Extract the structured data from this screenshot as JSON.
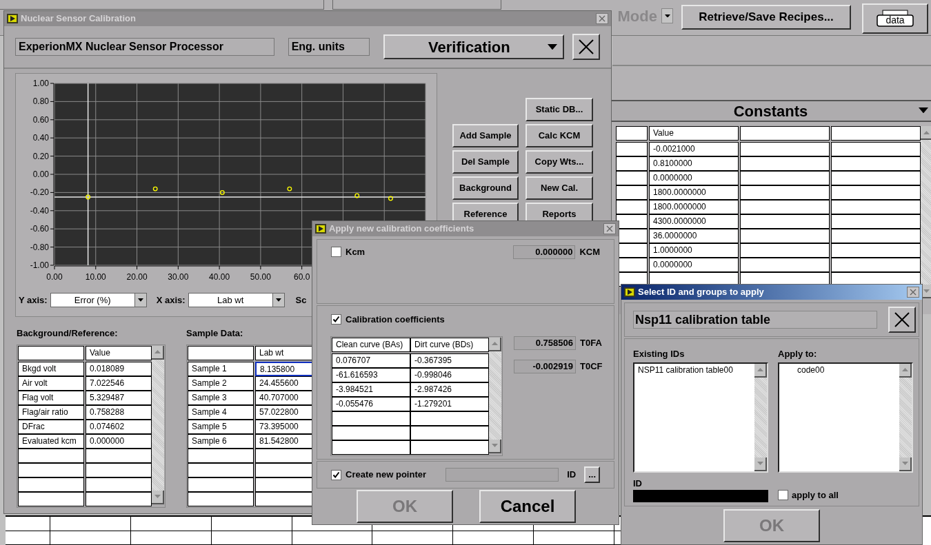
{
  "background_app": {
    "mode_dropdown": {
      "value": "Mode",
      "disabled": true
    },
    "recipes_button": "Retrieve/Save Recipes...",
    "data_button": "data",
    "constants": {
      "title": "Constants",
      "columns": [
        "Value"
      ],
      "rows": [
        "-0.0021000",
        "0.8100000",
        "0.0000000",
        "1800.0000000",
        "1800.0000000",
        "4300.0000000",
        "36.0000000",
        "1.0000000",
        "0.0000000"
      ]
    }
  },
  "main_window": {
    "title": "Nuclear Sensor Calibration",
    "active": false,
    "processor": "ExperionMX Nuclear Sensor Processor",
    "units": "Eng. units",
    "view": "Verification",
    "chart_data": {
      "type": "scatter",
      "x": [
        8.1358,
        24.4556,
        40.707,
        57.0228,
        73.395,
        81.5428
      ],
      "series": [
        {
          "color": "#ffff00",
          "values": [
            -0.25,
            -0.16,
            -0.2,
            -0.16,
            -0.235,
            -0.265
          ]
        }
      ],
      "xlim": [
        0,
        90
      ],
      "ylim": [
        -1,
        1
      ],
      "xticks": [
        {
          "value": 0,
          "label": "0.00"
        },
        {
          "value": 10,
          "label": "10.00"
        },
        {
          "value": 20,
          "label": "20.00"
        },
        {
          "value": 30,
          "label": "30.00"
        },
        {
          "value": 40,
          "label": "40.00"
        },
        {
          "value": 50,
          "label": "50.00"
        },
        {
          "value": 60,
          "label": "60.0"
        }
      ],
      "yticks": [
        {
          "value": 1,
          "label": "1.00"
        },
        {
          "value": 0.8,
          "label": "0.80"
        },
        {
          "value": 0.6,
          "label": "0.60"
        },
        {
          "value": 0.4,
          "label": "0.40"
        },
        {
          "value": 0.2,
          "label": "0.20"
        },
        {
          "value": 0,
          "label": "0.00"
        },
        {
          "value": -0.2,
          "label": "-0.20"
        },
        {
          "value": -0.4,
          "label": "-0.40"
        },
        {
          "value": -0.6,
          "label": "-0.60"
        },
        {
          "value": -0.8,
          "label": "-0.80"
        },
        {
          "value": -1,
          "label": "-1.00"
        }
      ],
      "grid": true,
      "ref_lines": [
        {
          "axis": "x",
          "value": 8.1358,
          "color": "#e8e8e8"
        },
        {
          "axis": "y",
          "value": -0.25,
          "color": "#e8e8e8"
        }
      ]
    },
    "y_axis": {
      "label": "Y axis:",
      "value": "Error (%)"
    },
    "x_axis": {
      "label": "X axis:",
      "value": "Lab wt"
    },
    "cut_label": "Sc",
    "left_buttons": [
      "Add Sample",
      "Del Sample",
      "Background",
      "Reference"
    ],
    "right_buttons": [
      "Static DB...",
      "Calc KCM",
      "Copy Wts...",
      "New Cal.",
      "Reports"
    ],
    "background_reference": {
      "title": "Background/Reference:",
      "columns": [
        "Value"
      ],
      "rows": [
        {
          "label": "Bkgd volt",
          "value": "0.018089"
        },
        {
          "label": "Air volt",
          "value": "7.022546"
        },
        {
          "label": "Flag volt",
          "value": "5.329487"
        },
        {
          "label": "Flag/air ratio",
          "value": "0.758288"
        },
        {
          "label": "DFrac",
          "value": "0.074602"
        },
        {
          "label": "Evaluated kcm",
          "value": "0.000000"
        }
      ]
    },
    "sample_data": {
      "title": "Sample Data:",
      "columns": [
        "Lab wt"
      ],
      "rows": [
        {
          "label": "Sample 1",
          "value": "8.135800",
          "selected": true
        },
        {
          "label": "Sample 2",
          "value": "24.455600",
          "selected": false
        },
        {
          "label": "Sample 3",
          "value": "40.707000",
          "selected": false
        },
        {
          "label": "Sample 4",
          "value": "57.022800",
          "selected": false
        },
        {
          "label": "Sample 5",
          "value": "73.395000",
          "selected": false
        },
        {
          "label": "Sample 6",
          "value": "81.542800",
          "selected": false
        }
      ]
    }
  },
  "apply_dialog": {
    "title": "Apply new calibration coefficients",
    "active": false,
    "kcm": {
      "label": "Kcm",
      "checked": false,
      "value": "0.000000",
      "unit": "KCM"
    },
    "coefficients": {
      "label": "Calibration coefficients",
      "checked": true,
      "columns": [
        "Clean curve (BAs)",
        "Dirt curve (BDs)"
      ],
      "rows": [
        [
          "0.076707",
          "-0.367395"
        ],
        [
          "-61.616593",
          "-0.998046"
        ],
        [
          "-3.984521",
          "-2.987426"
        ],
        [
          "-0.055476",
          "-1.279201"
        ]
      ],
      "outputs": [
        {
          "value": "0.758506",
          "unit": "T0FA"
        },
        {
          "value": "-0.002919",
          "unit": "T0CF"
        }
      ]
    },
    "pointer": {
      "label": "Create new pointer",
      "checked": true,
      "id_label": "ID",
      "browse": "..."
    },
    "ok": {
      "label": "OK",
      "disabled": true
    },
    "cancel": {
      "label": "Cancel",
      "disabled": false
    }
  },
  "select_dialog": {
    "title": "Select ID and groups to apply",
    "active": true,
    "table_name": "Nsp11 calibration table",
    "existing_ids": {
      "label": "Existing IDs",
      "items": [
        "NSP11 calibration table00"
      ]
    },
    "apply_to": {
      "label": "Apply to:",
      "items": [
        "code00"
      ]
    },
    "id_label": "ID",
    "apply_all": {
      "label": "apply to all",
      "checked": false
    },
    "ok": {
      "label": "OK",
      "disabled": true
    }
  }
}
